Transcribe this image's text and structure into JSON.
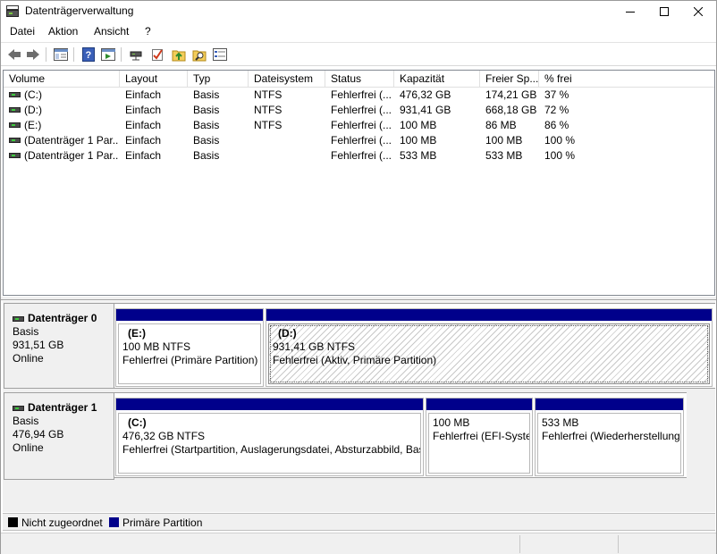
{
  "window": {
    "title": "Datenträgerverwaltung",
    "icon": "disk-management-icon"
  },
  "menu": [
    "Datei",
    "Aktion",
    "Ansicht",
    "?"
  ],
  "toolbar": {
    "icons": [
      "back-arrow-icon",
      "forward-arrow-icon",
      "console-tree-icon",
      "help-icon",
      "export-list-icon",
      "connect-drive-icon",
      "check-icon",
      "up-folder-icon",
      "search-folder-icon",
      "properties-icon"
    ]
  },
  "volume_list": {
    "columns": [
      "Volume",
      "Layout",
      "Typ",
      "Dateisystem",
      "Status",
      "Kapazität",
      "Freier Sp...",
      "% frei"
    ],
    "rows": [
      [
        "(C:)",
        "Einfach",
        "Basis",
        "NTFS",
        "Fehlerfrei (...",
        "476,32 GB",
        "174,21 GB",
        "37 %"
      ],
      [
        "(D:)",
        "Einfach",
        "Basis",
        "NTFS",
        "Fehlerfrei (...",
        "931,41 GB",
        "668,18 GB",
        "72 %"
      ],
      [
        "(E:)",
        "Einfach",
        "Basis",
        "NTFS",
        "Fehlerfrei (...",
        "100 MB",
        "86 MB",
        "86 %"
      ],
      [
        "(Datenträger 1 Par...",
        "Einfach",
        "Basis",
        "",
        "Fehlerfrei (...",
        "100 MB",
        "100 MB",
        "100 %"
      ],
      [
        "(Datenträger 1 Par...",
        "Einfach",
        "Basis",
        "",
        "Fehlerfrei (...",
        "533 MB",
        "533 MB",
        "100 %"
      ]
    ]
  },
  "disks": [
    {
      "name": "Datenträger 0",
      "type": "Basis",
      "size": "931,51 GB",
      "state": "Online",
      "partitions": [
        {
          "name": "(E:)",
          "size": "100 MB NTFS",
          "status": "Fehlerfrei (Primäre Partition)",
          "hatched": false
        },
        {
          "name": "(D:)",
          "size": "931,41 GB NTFS",
          "status": "Fehlerfrei (Aktiv, Primäre Partition)",
          "hatched": true
        }
      ]
    },
    {
      "name": "Datenträger 1",
      "type": "Basis",
      "size": "476,94 GB",
      "state": "Online",
      "partitions": [
        {
          "name": "(C:)",
          "size": "476,32 GB NTFS",
          "status": "Fehlerfrei (Startpartition, Auslagerungsdatei, Absturzabbild, Bas",
          "hatched": false
        },
        {
          "name": "",
          "size": "100 MB",
          "status": "Fehlerfrei (EFI-Systen",
          "hatched": false
        },
        {
          "name": "",
          "size": "533 MB",
          "status": "Fehlerfrei (Wiederherstellung",
          "hatched": false
        }
      ]
    }
  ],
  "legend": [
    {
      "label": "Nicht zugeordnet",
      "color": "#000000"
    },
    {
      "label": "Primäre Partition",
      "color": "#00008b"
    }
  ],
  "colors": {
    "partition_bar": "#00008b",
    "pane_bg": "#f0f0f0"
  }
}
